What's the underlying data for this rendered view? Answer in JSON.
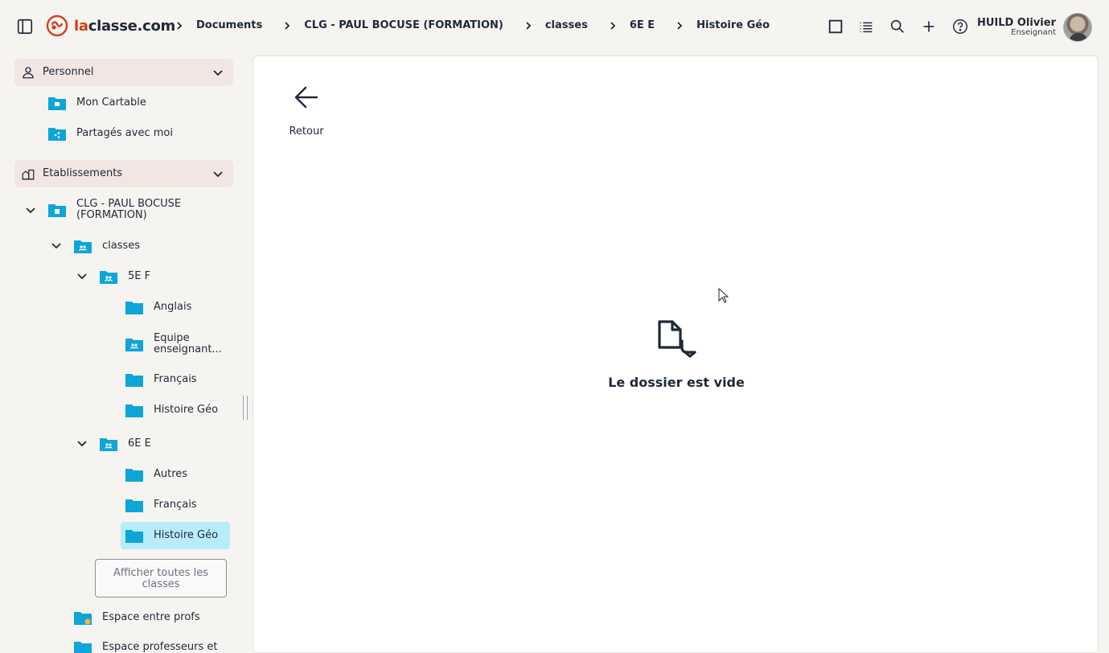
{
  "brand": {
    "prefix": "la",
    "suffix": "classe.com"
  },
  "breadcrumb": [
    "Documents",
    "CLG - PAUL BOCUSE (FORMATION)",
    "classes",
    "6E E",
    "Histoire Géo"
  ],
  "user": {
    "name": "HUILD Olivier",
    "role": "Enseignant"
  },
  "sidebar": {
    "personnel": {
      "label": "Personnel",
      "items": [
        "Mon Cartable",
        "Partagés avec moi"
      ]
    },
    "etablissements": {
      "label": "Etablissements",
      "school": "CLG - PAUL BOCUSE (FORMATION)",
      "classes": "classes",
      "class_5e": {
        "label": "5E F",
        "items": [
          "Anglais",
          "Equipe enseignant...",
          "Français",
          "Histoire Géo"
        ]
      },
      "class_6e": {
        "label": "6E E",
        "items": [
          "Autres",
          "Français",
          "Histoire Géo"
        ]
      },
      "show_all": "Afficher toutes les classes",
      "extra": [
        "Espace entre profs",
        "Espace professeurs et"
      ]
    }
  },
  "main": {
    "back_label": "Retour",
    "empty_message": "Le dossier est vide"
  },
  "colors": {
    "accent": "#d2401c",
    "folder": "#0ea5d9",
    "selected": "#b8ecf9",
    "section_bg": "#f1e6e2"
  }
}
